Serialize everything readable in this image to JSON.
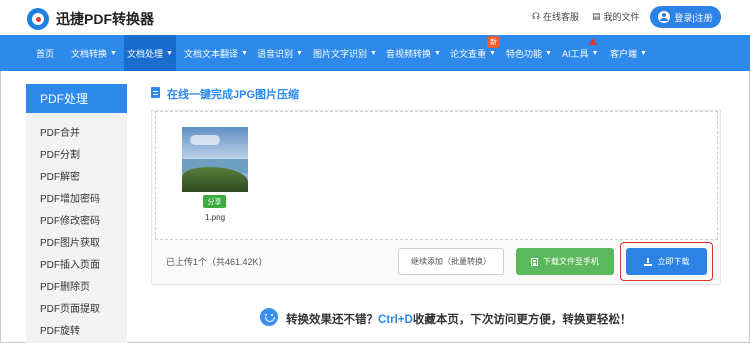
{
  "header": {
    "brand": "迅捷PDF转换器",
    "service": "在线客服",
    "my_files": "我的文件",
    "login": "登录|注册"
  },
  "nav": {
    "items": [
      {
        "label": "首页",
        "caret": false,
        "active": false
      },
      {
        "label": "文档转换",
        "caret": true,
        "active": false
      },
      {
        "label": "文档处理",
        "caret": true,
        "active": true
      },
      {
        "label": "文档文本翻译",
        "caret": true,
        "active": false
      },
      {
        "label": "语音识别",
        "caret": true,
        "active": false
      },
      {
        "label": "图片文字识别",
        "caret": true,
        "active": false
      },
      {
        "label": "音视频转换",
        "caret": true,
        "active": false
      },
      {
        "label": "论文查重",
        "caret": true,
        "active": false
      },
      {
        "label": "特色功能",
        "caret": true,
        "active": false
      },
      {
        "label": "AI工具",
        "caret": true,
        "active": false
      },
      {
        "label": "客户端",
        "caret": true,
        "active": false
      }
    ],
    "badge_new": "新"
  },
  "sidebar": {
    "title": "PDF处理",
    "items": [
      "PDF合并",
      "PDF分割",
      "PDF解密",
      "PDF增加密码",
      "PDF修改密码",
      "PDF图片获取",
      "PDF插入页面",
      "PDF删除页",
      "PDF页面提取",
      "PDF旋转"
    ]
  },
  "main": {
    "title": "在线一键完成JPG图片压缩",
    "file": {
      "share_label": "分享",
      "name": "1.png"
    },
    "upload_info": "已上传1个（共461.42K）",
    "btn_add": "继续添加（批量转换）",
    "btn_phone": "下载文件至手机",
    "btn_download": "立即下载"
  },
  "tip": {
    "before": "转换效果还不错？",
    "shortcut": "Ctrl+D",
    "after": "收藏本页，下次访问更方便，转换更轻松！"
  },
  "colors": {
    "primary": "#2d89ea",
    "active_nav": "#1a6dcc",
    "green": "#5cb85c",
    "highlight_red": "#e0342b"
  }
}
